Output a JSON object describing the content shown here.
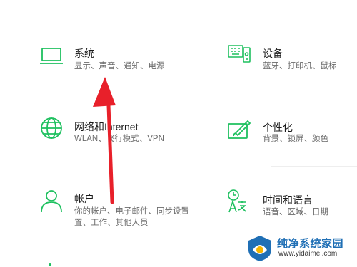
{
  "accent": "#1ec05f",
  "tiles": [
    {
      "title": "系统",
      "sub": [
        "显示、声音、通知、电源"
      ],
      "icon": "laptop-icon"
    },
    {
      "title": "设备",
      "sub": [
        "蓝牙、打印机、鼠标"
      ],
      "icon": "keyboard-device-icon"
    },
    {
      "title": "网络和Internet",
      "sub": [
        "WLAN、飞行模式、VPN"
      ],
      "icon": "globe-icon"
    },
    {
      "title": "个性化",
      "sub": [
        "背景、锁屏、颜色"
      ],
      "icon": "paint-brush-icon"
    },
    {
      "title": "帐户",
      "sub": [
        "你的帐户、电子邮件、同步设置",
        "置、工作、其他人员"
      ],
      "icon": "person-icon"
    },
    {
      "title": "时间和语言",
      "sub": [
        "语音、区域、日期"
      ],
      "icon": "time-language-icon"
    }
  ],
  "watermark": {
    "title": "纯净系统家园",
    "url": "www.yidaimei.com"
  }
}
